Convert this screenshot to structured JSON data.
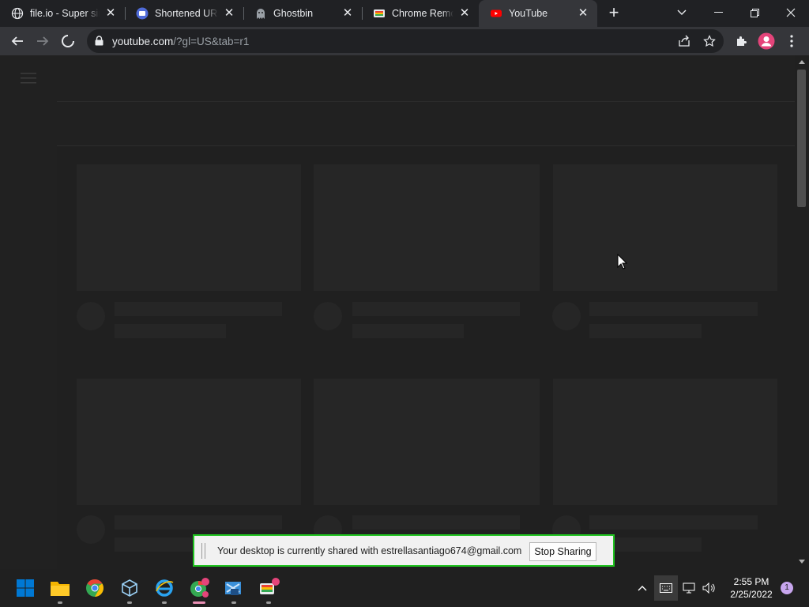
{
  "browser": {
    "tabs": [
      {
        "title": "file.io - Super simple file sharing",
        "favicon": "globe-icon"
      },
      {
        "title": "Shortened URL",
        "favicon": "chat-icon"
      },
      {
        "title": "Ghostbin",
        "favicon": "ghost-icon"
      },
      {
        "title": "Chrome Remote Desktop",
        "favicon": "remote-desktop-icon"
      },
      {
        "title": "YouTube",
        "favicon": "youtube-icon",
        "active": true
      }
    ],
    "new_tab": "+",
    "url_host": "youtube.com",
    "url_rest": "/?gl=US&tab=r1"
  },
  "share_bar": {
    "message": "Your desktop is currently shared with estrellasantiago674@gmail.com",
    "stop_label": "Stop Sharing"
  },
  "taskbar": {
    "time": "2:55 PM",
    "date": "2/25/2022",
    "notification_count": "1",
    "apps": [
      "start",
      "file-explorer",
      "chrome",
      "virtualbox",
      "edge",
      "chrome-profile",
      "tools",
      "remote-desktop"
    ]
  },
  "colors": {
    "page_bg": "#202020",
    "placeholder": "#262626",
    "share_border": "#20c320",
    "windows_blue": "#0078d4"
  }
}
